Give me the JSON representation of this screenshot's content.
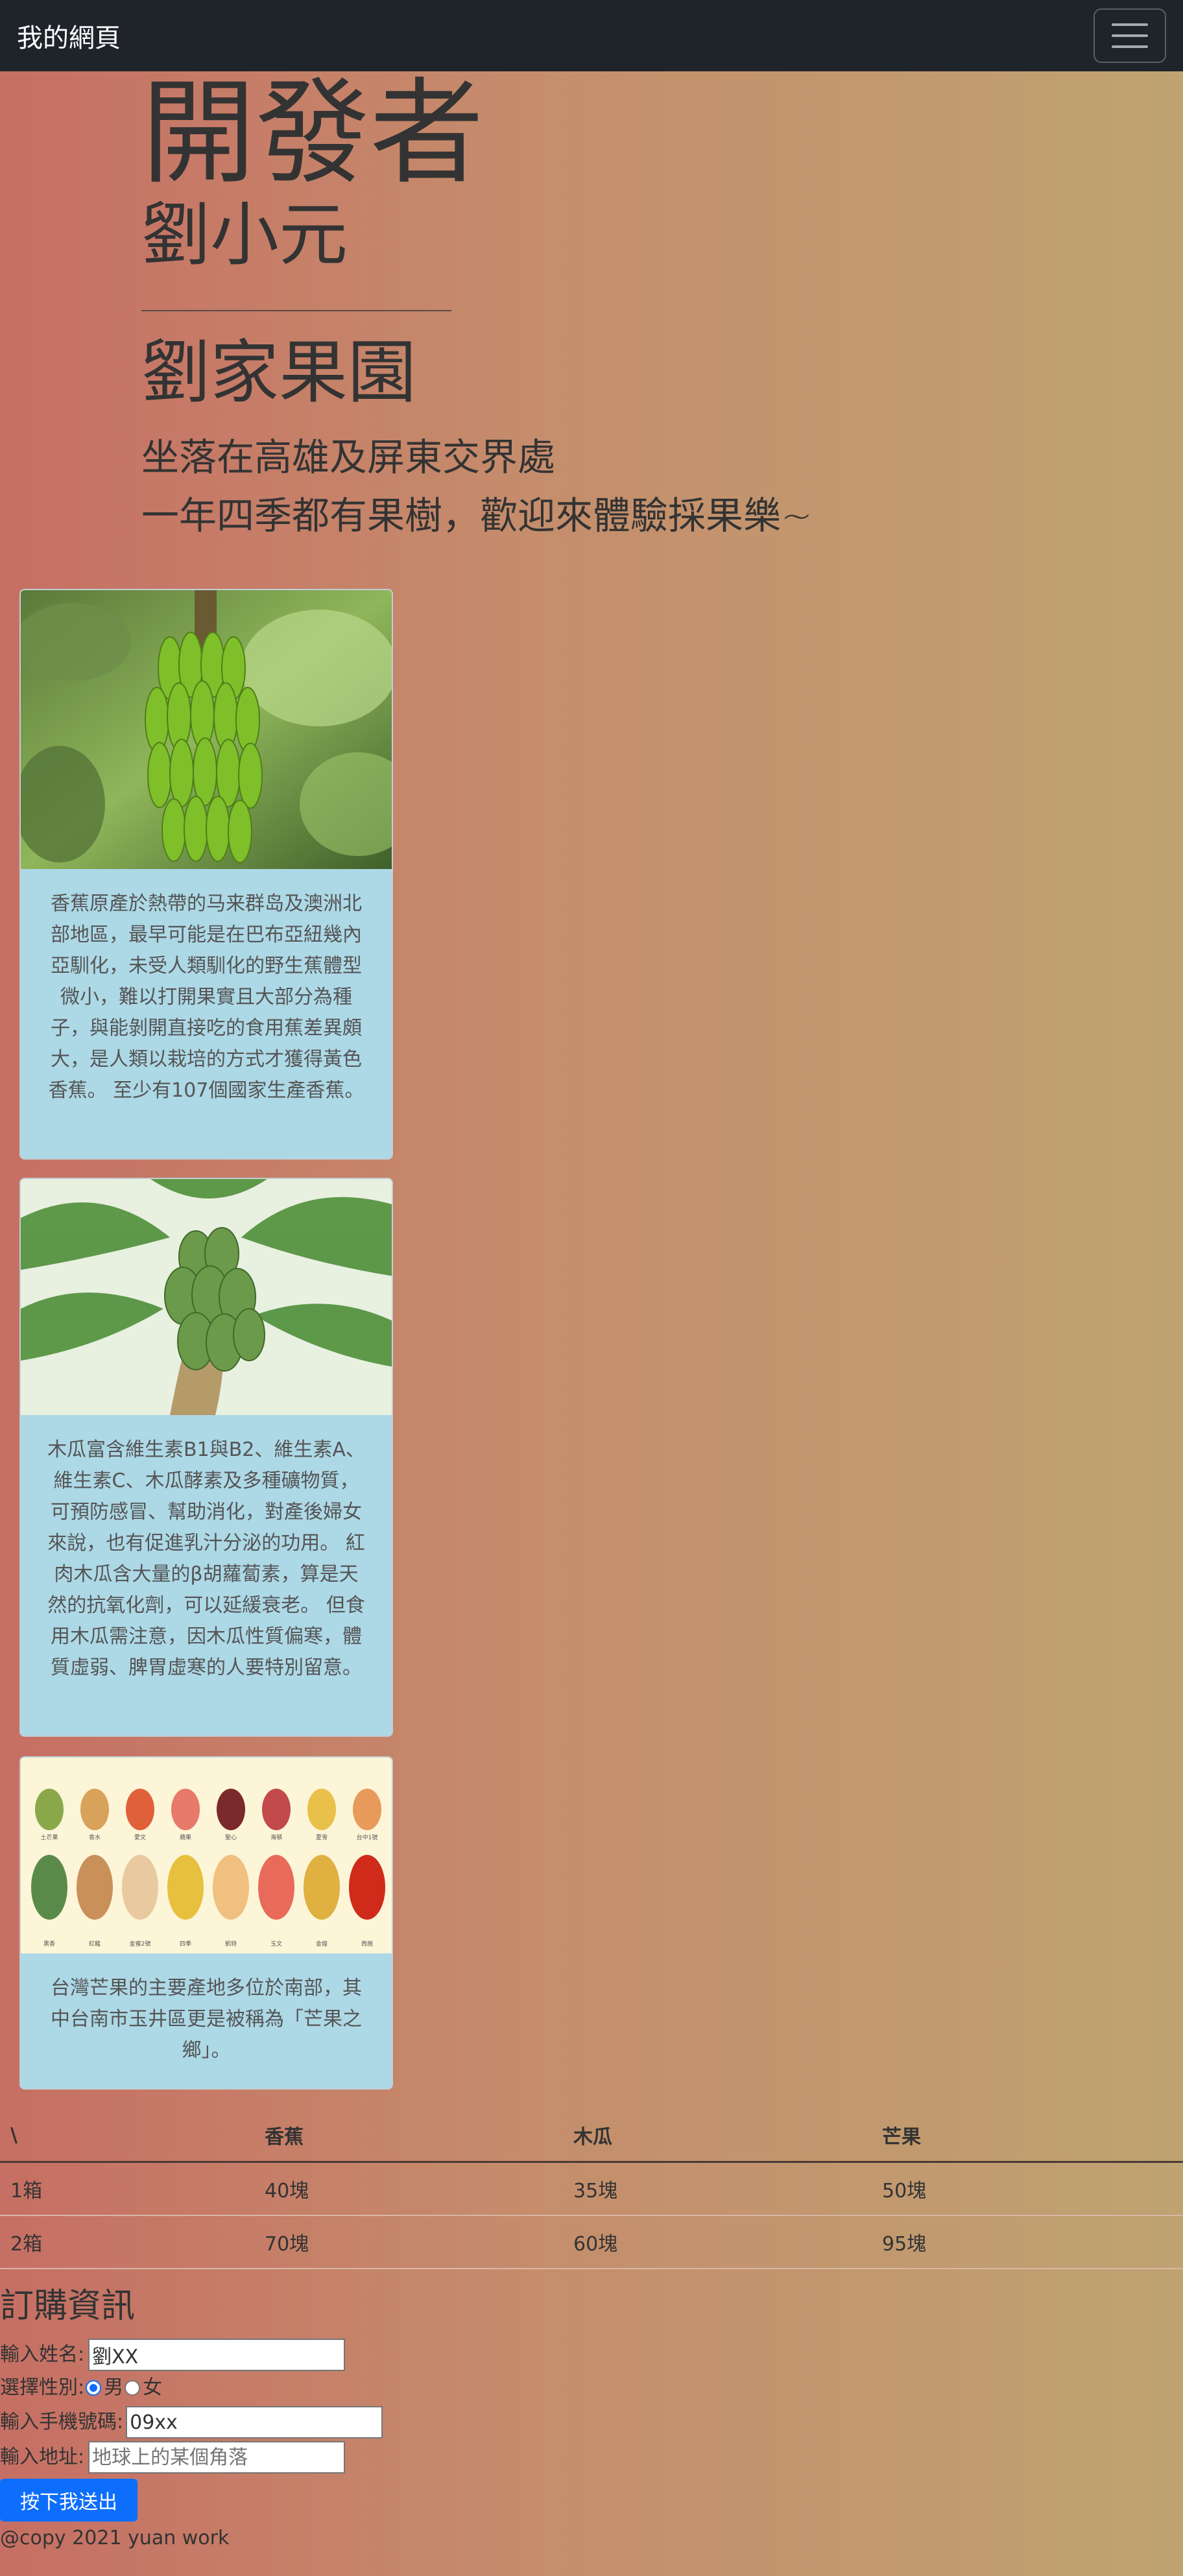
{
  "navbar": {
    "brand": "我的網頁"
  },
  "hero": {
    "title": "開發者",
    "name": "劉小元",
    "farm": "劉家果園",
    "line1": "坐落在高雄及屏東交界處",
    "line2": "一年四季都有果樹，歡迎來體驗採果樂~"
  },
  "cards": [
    {
      "desc": "香蕉原產於熱帶的马来群岛及澳洲北部地區，最早可能是在巴布亞紐幾內亞馴化，未受人類馴化的野生蕉體型微小，難以打開果實且大部分為種子，與能剝開直接吃的食用蕉差異頗大，是人類以栽培的方式才獲得黃色香蕉。 至少有107個國家生產香蕉。"
    },
    {
      "desc": "木瓜富含維生素B1與B2、維生素A、維生素C、木瓜酵素及多種礦物質，可預防感冒、幫助消化，對產後婦女來說，也有促進乳汁分泌的功用。 紅肉木瓜含大量的β胡蘿蔔素，算是天然的抗氧化劑，可以延緩衰老。 但食用木瓜需注意，因木瓜性質偏寒，體質虛弱、脾胃虛寒的人要特別留意。"
    },
    {
      "desc": "台灣芒果的主要產地多位於南部，其中台南市玉井區更是被稱為「芒果之鄉」。"
    }
  ],
  "mango_labels": [
    "土芒果",
    "香水",
    "愛文",
    "蘋果",
    "聖心",
    "海頓",
    "夏雪",
    "台中1號",
    "黑香",
    "紅龍",
    "金蜜2號",
    "四季",
    "凱特",
    "玉文",
    "金煌",
    "西施"
  ],
  "table": {
    "headers": [
      "\\",
      "香蕉",
      "木瓜",
      "芒果"
    ],
    "rows": [
      [
        "1箱",
        "40塊",
        "35塊",
        "50塊"
      ],
      [
        "2箱",
        "70塊",
        "60塊",
        "95塊"
      ]
    ]
  },
  "order": {
    "title": "訂購資訊",
    "name_label": "輸入姓名:",
    "name_value": "劉XX",
    "gender_label": "選擇性別:",
    "male": "男",
    "female": "女",
    "phone_label": "輸入手機號碼:",
    "phone_value": "09xx",
    "address_label": "輸入地址:",
    "address_placeholder": "地球上的某個角落",
    "submit": "按下我送出"
  },
  "footer": "@copy 2021 yuan work"
}
